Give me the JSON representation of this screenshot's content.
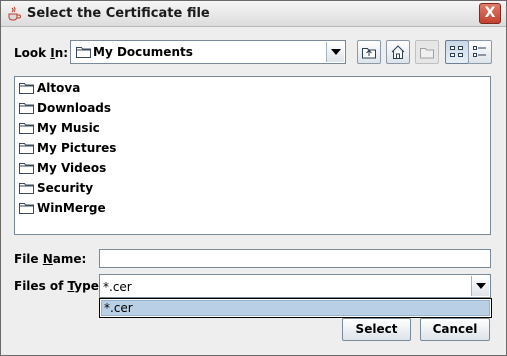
{
  "window": {
    "title": "Select the Certificate file",
    "close_label": "X"
  },
  "lookin": {
    "label_prefix": "Look ",
    "label_mnemonic": "I",
    "label_suffix": "n:",
    "value": "My Documents"
  },
  "toolbar": {
    "buttons": [
      "up-one-level",
      "home",
      "new-folder",
      "list-view",
      "details-view"
    ]
  },
  "files": [
    {
      "name": "Altova"
    },
    {
      "name": "Downloads"
    },
    {
      "name": "My Music"
    },
    {
      "name": "My Pictures"
    },
    {
      "name": "My Videos"
    },
    {
      "name": "Security"
    },
    {
      "name": "WinMerge"
    }
  ],
  "filename": {
    "label_prefix": "File ",
    "label_mnemonic": "N",
    "label_suffix": "ame:",
    "value": ""
  },
  "filetype": {
    "label_prefix": "Files of ",
    "label_mnemonic": "T",
    "label_suffix": "ype:",
    "value": "*.cer",
    "options": [
      "*.cer"
    ]
  },
  "buttons": {
    "select_label": "Select",
    "cancel_label": "Cancel"
  },
  "colors": {
    "selection": "#b8cfe5",
    "close_button": "#c2412d"
  }
}
